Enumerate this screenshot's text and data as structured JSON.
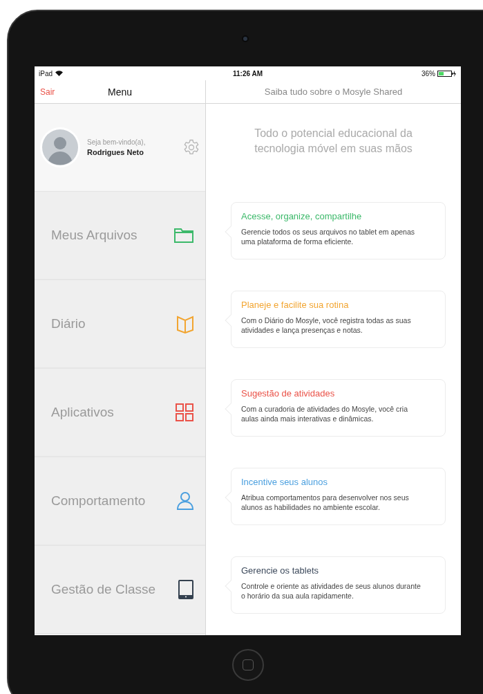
{
  "status_bar": {
    "device": "iPad",
    "time": "11:26 AM",
    "battery": "36%"
  },
  "nav": {
    "back": "Sair",
    "menu_title": "Menu",
    "detail_title": "Saiba tudo sobre o Mosyle Shared"
  },
  "profile": {
    "greeting": "Seja bem-vindo(a),",
    "name": "Rodrigues Neto"
  },
  "menu_items": [
    {
      "label": "Meus Arquivos",
      "color": "#3cb96a"
    },
    {
      "label": "Diário",
      "color": "#f2a531"
    },
    {
      "label": "Aplicativos",
      "color": "#ea5248"
    },
    {
      "label": "Comportamento",
      "color": "#4a9fdf"
    },
    {
      "label": "Gestão de Classe",
      "color": "#34414f"
    }
  ],
  "headline": "Todo o potencial educacional da tecnologia móvel em suas mãos",
  "cards": [
    {
      "title": "Acesse, organize, compartilhe",
      "text": "Gerencie todos os seus arquivos no tablet em apenas uma plataforma de forma eficiente.",
      "color": "#3cb96a"
    },
    {
      "title": "Planeje e facilite sua rotina",
      "text": "Com o Diário do Mosyle, você registra todas as suas atividades e lança presenças e notas.",
      "color": "#f2a531"
    },
    {
      "title": "Sugestão de atividades",
      "text": "Com a curadoria de atividades do Mosyle, você cria aulas ainda mais interativas e dinâmicas.",
      "color": "#ea5248"
    },
    {
      "title": "Incentive seus alunos",
      "text": "Atribua comportamentos para desenvolver nos seus alunos as habilidades no ambiente escolar.",
      "color": "#4a9fdf"
    },
    {
      "title": "Gerencie os tablets",
      "text": "Controle e oriente as atividades de seus alunos durante o horário da sua aula rapidamente.",
      "color": "#3d4a5c"
    }
  ]
}
